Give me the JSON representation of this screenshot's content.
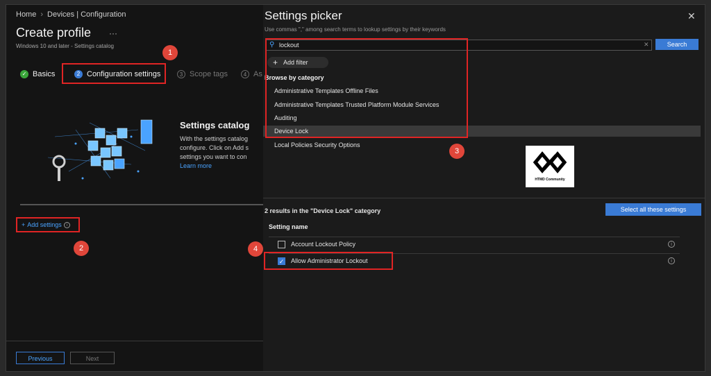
{
  "breadcrumb": [
    "Home",
    "Devices | Configuration"
  ],
  "page": {
    "title": "Create profile",
    "ellipsis": "···",
    "subtitle": "Windows 10 and later - Settings catalog"
  },
  "steps": [
    {
      "label": "Basics",
      "state": "done",
      "marker": "✓"
    },
    {
      "label": "Configuration settings",
      "state": "active",
      "marker": "2"
    },
    {
      "label": "Scope tags",
      "state": "pending",
      "marker": "3"
    },
    {
      "label": "As",
      "state": "pending",
      "marker": "4"
    }
  ],
  "catalog": {
    "title": "Settings catalog",
    "description": "With the settings catalog configure. Click on Add s settings you want to con",
    "learn_more": "Learn more"
  },
  "add_settings_label": "Add settings",
  "footer": {
    "previous": "Previous",
    "next": "Next"
  },
  "picker": {
    "title": "Settings picker",
    "subtitle": "Use commas \",\" among search terms to lookup settings by their keywords",
    "search_value": "lockout",
    "search_button": "Search",
    "add_filter": "Add filter",
    "browse_title": "Browse by category",
    "categories": [
      "Administrative Templates Offline Files",
      "Administrative Templates Trusted Platform Module Services",
      "Auditing",
      "Device Lock",
      "Local Policies Security Options"
    ],
    "selected_category": "Device Lock",
    "results_text": "2 results in the \"Device Lock\" category",
    "select_all": "Select all these settings",
    "column_header": "Setting name",
    "settings": [
      {
        "name": "Account Lockout Policy",
        "checked": false
      },
      {
        "name": "Allow Administrator Lockout",
        "checked": true
      }
    ]
  },
  "logo_text": "HTMD Community",
  "badges": [
    "1",
    "2",
    "3",
    "4"
  ],
  "colors": {
    "accent": "#3a7bd5",
    "annotation": "#e02424",
    "success": "#3aa53a"
  }
}
